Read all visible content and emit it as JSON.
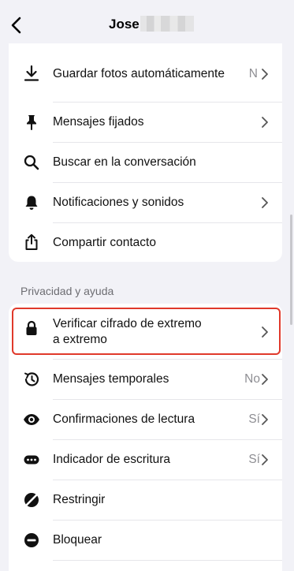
{
  "header": {
    "back_icon": "chevron-left-icon",
    "title": "Jose"
  },
  "settings": {
    "items": [
      {
        "label": "Guardar fotos automáticamente",
        "value": "N",
        "icon": "download-icon"
      },
      {
        "label": "Mensajes fijados",
        "icon": "pin-icon"
      },
      {
        "label": "Buscar en la conversación",
        "icon": "search-icon"
      },
      {
        "label": "Notificaciones y sonidos",
        "icon": "bell-icon"
      },
      {
        "label": "Compartir contacto",
        "icon": "share-icon"
      }
    ]
  },
  "privacy": {
    "section_label": "Privacidad y ayuda",
    "items": [
      {
        "label_line1": "Verificar cifrado de extremo",
        "label_line2": "a extremo",
        "icon": "lock-icon"
      },
      {
        "label": "Mensajes temporales",
        "value": "No",
        "icon": "timer-icon"
      },
      {
        "label": "Confirmaciones de lectura",
        "value": "Sí",
        "icon": "eye-icon"
      },
      {
        "label": "Indicador de escritura",
        "value": "Sí",
        "icon": "typing-icon"
      },
      {
        "label": "Restringir",
        "icon": "restrict-icon"
      },
      {
        "label": "Bloquear",
        "icon": "block-icon"
      }
    ]
  },
  "colors": {
    "highlight": "#e0392b",
    "background": "#f2f2f7"
  }
}
